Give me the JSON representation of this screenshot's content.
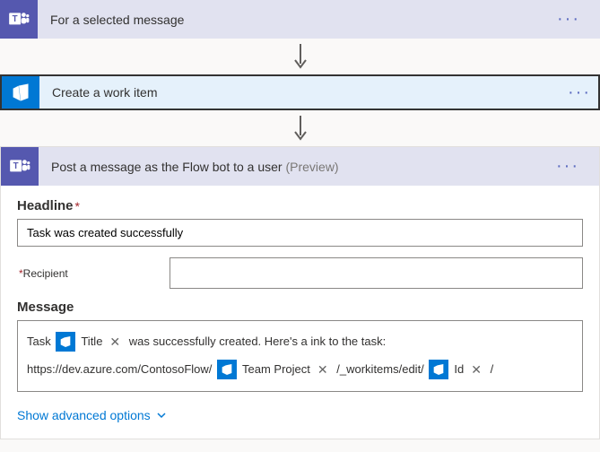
{
  "step1": {
    "title": "For a selected message"
  },
  "step2": {
    "title": "Create a work item"
  },
  "step3": {
    "title": "Post a message as the Flow bot to a user ",
    "preview": "(Preview)",
    "headline_label": "Headline",
    "headline_value": "Task was created successfully",
    "recipient_label": "Recipient",
    "message_label": "Message",
    "msg_prefix": "Task ",
    "token_title": "Title",
    "msg_mid": " was successfully created. Here's a ink to the task:",
    "url_prefix": "https://dev.azure.com/ContosoFlow/ ",
    "token_teamproject": "Team Project",
    "url_mid": " /_workitems/edit/ ",
    "token_id": "Id",
    "url_suffix": " /"
  },
  "advanced": "Show advanced options"
}
